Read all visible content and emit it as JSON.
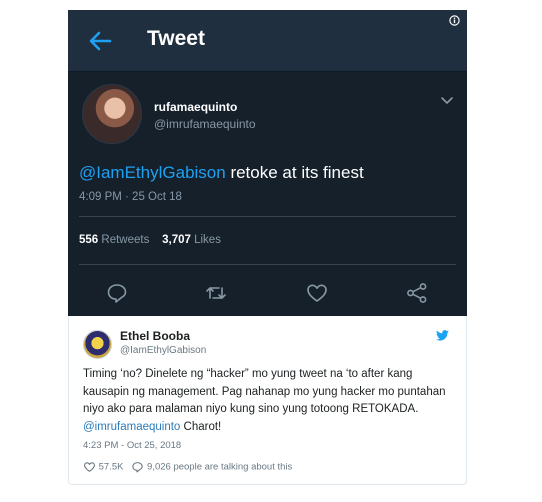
{
  "header": {
    "title": "Tweet",
    "back_icon": "arrow-left-icon",
    "info_icon": "info-circle-icon"
  },
  "tweet": {
    "display_name": "rufamaequinto",
    "handle": "@imrufamaequinto",
    "mention": "@IamEthylGabison",
    "text": " retoke at its finest",
    "time": "4:09 PM · 25 Oct 18",
    "retweets_count": "556",
    "retweets_label": "Retweets",
    "likes_count": "3,707",
    "likes_label": "Likes",
    "actions": [
      "reply-icon",
      "retweet-icon",
      "like-icon",
      "share-icon"
    ]
  },
  "embed": {
    "display_name": "Ethel Booba",
    "handle": "@IamEthylGabison",
    "text_main": "Timing ‘no? Dinelete ng “hacker” mo yung tweet na ‘to after kang kausapin ng management. Pag nahanap mo yung hacker mo puntahan niyo ako para malaman niyo kung sino yung totoong RETOKADA. ",
    "mention": "@imrufamaequinto",
    "text_end": " Charot!",
    "time": "4:23 PM - Oct 25, 2018",
    "likes": "57.5K",
    "talking": "9,026 people are talking about this"
  },
  "colors": {
    "dark_bg": "#15202b",
    "header_bg": "#1f2f3f",
    "accent": "#1da1f2",
    "muted": "#8899a6"
  }
}
